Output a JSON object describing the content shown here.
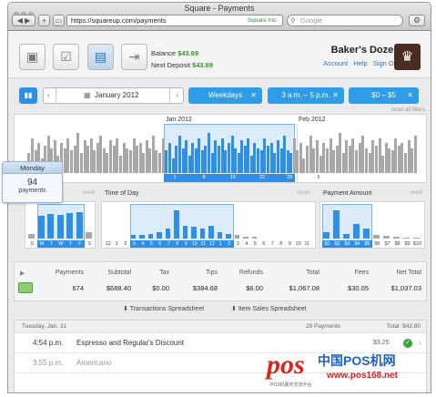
{
  "browser": {
    "title": "Square - Payments",
    "url": "https://squareup.com/payments",
    "site_label": "Square Inc.",
    "search_placeholder": "Google"
  },
  "header": {
    "balance_label": "Balance",
    "balance_value": "$43.69",
    "deposit_label": "Next Deposit",
    "deposit_value": "$43.69",
    "business_name": "Baker's Dozen",
    "links": [
      "Account",
      "Help",
      "Sign Out"
    ]
  },
  "filters": {
    "month": "January 2012",
    "chips": [
      "Weekdays",
      "3 a.m. – 5 p.m.",
      "$0 – $5"
    ],
    "reset_all": "reset all filters"
  },
  "timeline": {
    "month_labels": [
      "Jan 2012",
      "Feb 2012"
    ],
    "day_ticks": [
      "1",
      "8",
      "15",
      "22",
      "29",
      "5"
    ],
    "bars": [
      40,
      70,
      45,
      60,
      30,
      55,
      75,
      50,
      65,
      35,
      60,
      50,
      70,
      45,
      55,
      80,
      40,
      65,
      55,
      70,
      45,
      60,
      75,
      50,
      40,
      65,
      55,
      70,
      35,
      60,
      50,
      45,
      70,
      55,
      60,
      40,
      65,
      50,
      75,
      45
    ]
  },
  "day_of_week": {
    "label": "",
    "reset": "reset",
    "ticks": [
      "S",
      "M",
      "T",
      "W",
      "T",
      "F",
      "S"
    ],
    "bars": [
      0.15,
      0.7,
      0.75,
      0.72,
      0.78,
      0.8,
      0.2
    ]
  },
  "time_of_day": {
    "label": "Time of Day",
    "reset": "reset",
    "ticks": [
      "12",
      "1",
      "2",
      "3",
      "4",
      "5",
      "6",
      "7",
      "8",
      "9",
      "10",
      "11",
      "12",
      "1",
      "2",
      "3",
      "4",
      "5",
      "6",
      "7",
      "8",
      "9",
      "10",
      "11"
    ],
    "bars": [
      0,
      0,
      0,
      0.1,
      0.1,
      0.15,
      0.2,
      0.3,
      0.85,
      0.4,
      0.35,
      0.3,
      0.4,
      0.2,
      0.15,
      0.1,
      0.05,
      0.05,
      0,
      0,
      0,
      0,
      0,
      0
    ]
  },
  "payment_amount": {
    "label": "Payment Amount",
    "reset": "reset",
    "ticks": [
      "$1",
      "$2",
      "$3",
      "$4",
      "$5",
      "$6",
      "$7",
      "$8",
      "$9",
      "$10"
    ],
    "bars": [
      0.2,
      0.85,
      0.15,
      0.45,
      0.3,
      0.1,
      0.08,
      0.05,
      0.04,
      0.03
    ]
  },
  "popup": {
    "day": "Monday",
    "count": "94",
    "unit": "payments"
  },
  "stats": {
    "headers": [
      "Payments",
      "Subtotal",
      "Tax",
      "Tips",
      "Refunds",
      "Total",
      "Fees",
      "Net Total"
    ],
    "values": [
      "674",
      "$688.40",
      "$0.00",
      "$384.68",
      "$6.00",
      "$1,067.08",
      "$30.05",
      "$1,037.03"
    ]
  },
  "spreadsheets": [
    "Transactions Spreadsheet",
    "Item Sales Spreadsheet"
  ],
  "list": {
    "date": "Tuesday, Jan. 31",
    "count": "29 Payments",
    "total": "Total: $42.80",
    "rows": [
      {
        "time": "4:54 p.m.",
        "desc": "Espresso and Regular's Discount",
        "amount": "$3.25"
      },
      {
        "time": "3:55 p.m.",
        "desc": "Americano",
        "amount": ""
      }
    ]
  },
  "watermark": {
    "logo": "pos",
    "text": "中国POS机网",
    "url": "www.pos168.net",
    "tagline": "POS机服务交流平台"
  },
  "colors": {
    "accent": "#2e9ce6",
    "money_green": "#3b8f2f",
    "link": "#2a72c8"
  }
}
